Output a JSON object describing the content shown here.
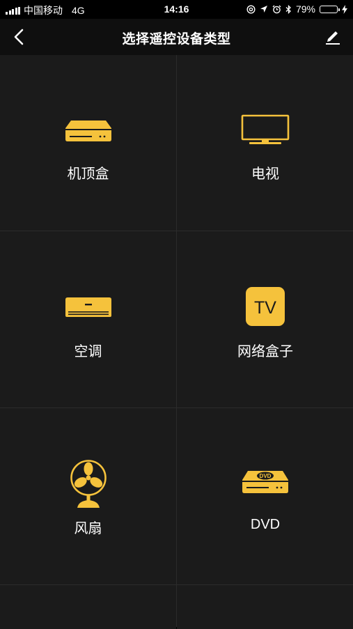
{
  "status_bar": {
    "carrier": "中国移动",
    "network": "4G",
    "time": "14:16",
    "battery_percent": "79%",
    "battery_level": 0.79,
    "battery_color": "#4cd964"
  },
  "nav": {
    "title": "选择遥控设备类型",
    "back_icon": "chevron-left-icon",
    "edit_icon": "pencil-icon"
  },
  "accent_color": "#f5c23c",
  "devices": [
    {
      "label": "机顶盒",
      "icon": "set-top-box-icon"
    },
    {
      "label": "电视",
      "icon": "tv-icon"
    },
    {
      "label": "空调",
      "icon": "air-conditioner-icon"
    },
    {
      "label": "网络盒子",
      "icon": "network-box-icon",
      "badge": "TV"
    },
    {
      "label": "风扇",
      "icon": "fan-icon"
    },
    {
      "label": "DVD",
      "icon": "dvd-player-icon",
      "badge": "DVD"
    }
  ]
}
